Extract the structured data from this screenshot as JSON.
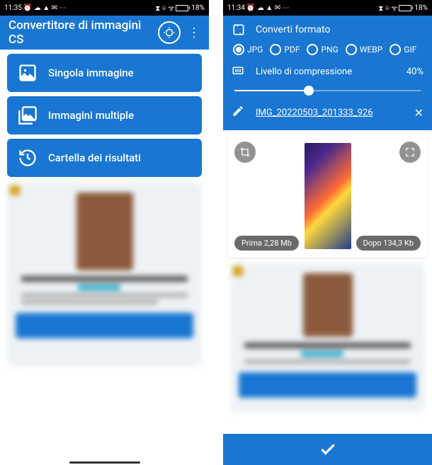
{
  "left": {
    "statusbar": {
      "time": "11:35",
      "battery": "18%",
      "icons": "⏰ ☁ ▲ ✉ ⋯",
      "right_icons": "⧗ ⌾ ᯤ"
    },
    "app_title": "Convertitore di immagini CS",
    "menu": {
      "single": "Singola immagine",
      "multiple": "Immagini multiple",
      "results": "Cartella dei risultati"
    }
  },
  "right": {
    "statusbar": {
      "time": "11:34",
      "battery": "18%",
      "icons": "⏰ ☁ ▲ ✉ ⋯",
      "right_icons": "⧗ ⌾ ᯤ"
    },
    "convert_label": "Converti formato",
    "formats": {
      "jpg": "JPG",
      "pdf": "PDF",
      "png": "PNG",
      "webp": "WEBP",
      "gif": "GIF",
      "selected": "jpg"
    },
    "compression": {
      "label": "Livello di compressione",
      "value": "40%"
    },
    "filename": "IMG_20220503_201333_926",
    "preview": {
      "before": "Prima 2,28 Mb",
      "after": "Dopo 134,3 Kb"
    }
  }
}
